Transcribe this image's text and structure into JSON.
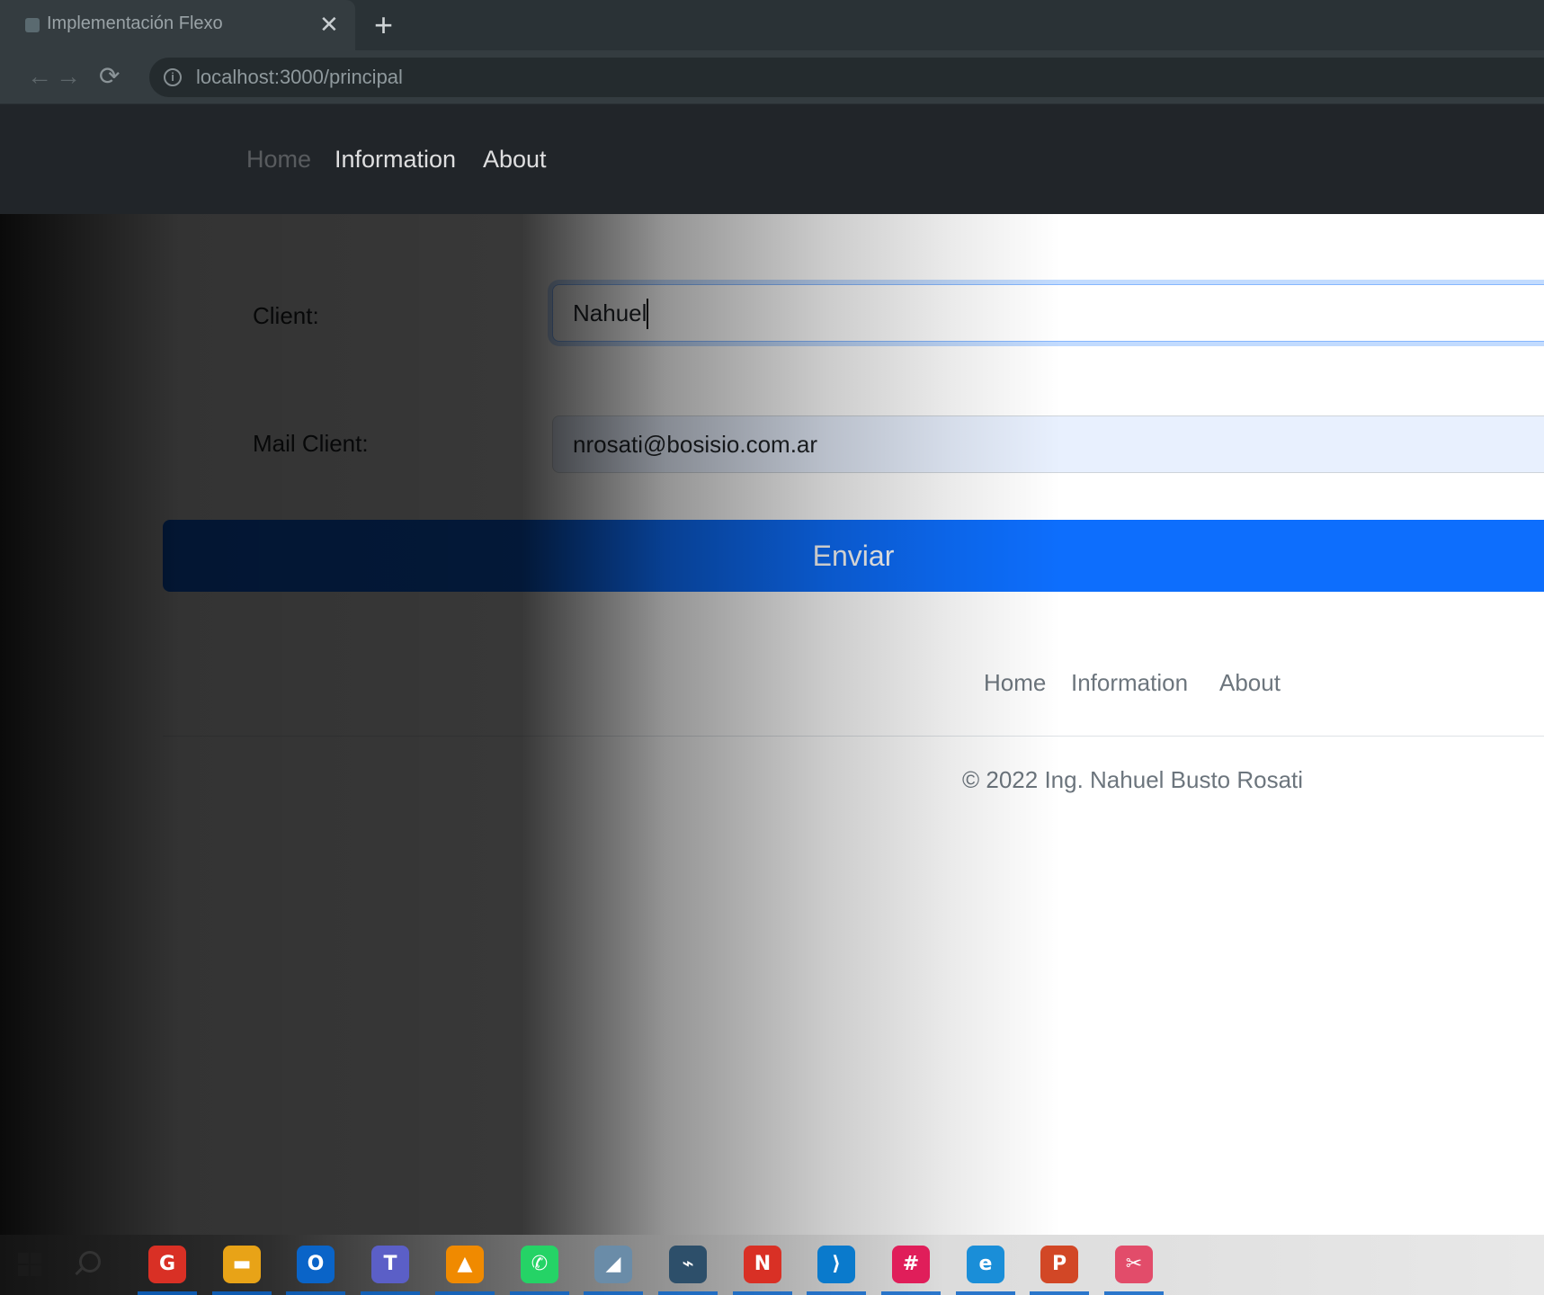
{
  "browser": {
    "tab_title": "Implementación Flexo",
    "tab_close": "✕",
    "new_tab": "+",
    "back": "←",
    "forward": "→",
    "reload": "⟳",
    "info": "i",
    "url": "localhost:3000/principal"
  },
  "navbar": {
    "links": [
      "Home",
      "Information",
      "About"
    ]
  },
  "form": {
    "client_label": "Client:",
    "client_value": "Nahuel",
    "mail_label": "Mail Client:",
    "mail_value": "nrosati@bosisio.com.ar",
    "submit_label": "Enviar"
  },
  "footer": {
    "links": [
      "Home",
      "Information",
      "About"
    ],
    "copyright": "© 2022 Ing. Nahuel Busto Rosati"
  },
  "taskbar": {
    "icons": [
      {
        "name": "chrome-icon",
        "glyph": "G",
        "color": "#d93025"
      },
      {
        "name": "file-explorer-icon",
        "glyph": "▬",
        "color": "#e8a317"
      },
      {
        "name": "outlook-icon",
        "glyph": "O",
        "color": "#0a64c8"
      },
      {
        "name": "teams-icon",
        "glyph": "T",
        "color": "#5b5fc7"
      },
      {
        "name": "vlc-icon",
        "glyph": "▲",
        "color": "#f08a00"
      },
      {
        "name": "whatsapp-icon",
        "glyph": "✆",
        "color": "#25d366"
      },
      {
        "name": "notes-icon",
        "glyph": "◢",
        "color": "#6a8ca8"
      },
      {
        "name": "mysql-workbench-icon",
        "glyph": "⌁",
        "color": "#2d4f6a"
      },
      {
        "name": "chrome-profile-icon",
        "glyph": "N",
        "color": "#d93025"
      },
      {
        "name": "vscode-icon",
        "glyph": "⟩",
        "color": "#0a7acc"
      },
      {
        "name": "slack-icon",
        "glyph": "#",
        "color": "#e01e5a"
      },
      {
        "name": "edge-icon",
        "glyph": "e",
        "color": "#1a8ed8"
      },
      {
        "name": "powerpoint-icon",
        "glyph": "P",
        "color": "#d24726"
      },
      {
        "name": "snipping-tool-icon",
        "glyph": "✂",
        "color": "#e24c6a"
      }
    ]
  }
}
